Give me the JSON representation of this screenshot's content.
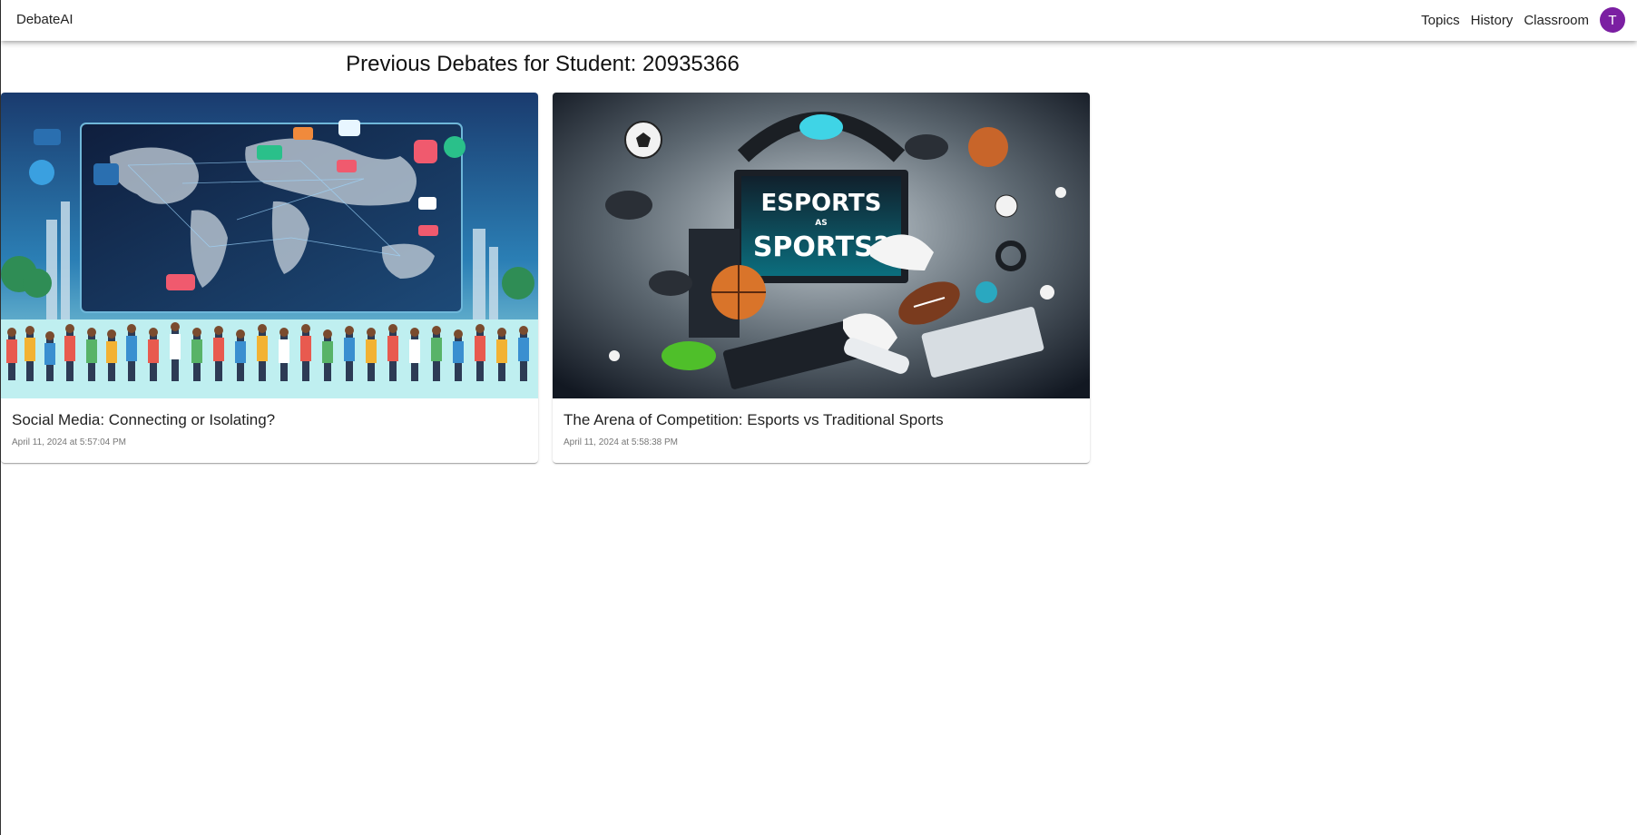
{
  "app": {
    "brand": "DebateAI"
  },
  "nav": {
    "items": [
      {
        "label": "Topics"
      },
      {
        "label": "History"
      },
      {
        "label": "Classroom"
      }
    ],
    "avatar_initial": "T",
    "avatar_color": "#7b1fa2"
  },
  "page": {
    "title": "Previous Debates for Student: 20935366"
  },
  "debates": [
    {
      "title": "Social Media: Connecting or Isolating?",
      "date": "April 11, 2024 at 5:57:04 PM",
      "image": "social-media-world-map-illustration"
    },
    {
      "title": "The Arena of Competition: Esports vs Traditional Sports",
      "date": "April 11, 2024 at 5:58:38 PM",
      "image": "esports-vs-sports-illustration",
      "image_text_top": "ESPORTS",
      "image_text_mid": "AS",
      "image_text_bottom": "SPORTS?"
    }
  ]
}
